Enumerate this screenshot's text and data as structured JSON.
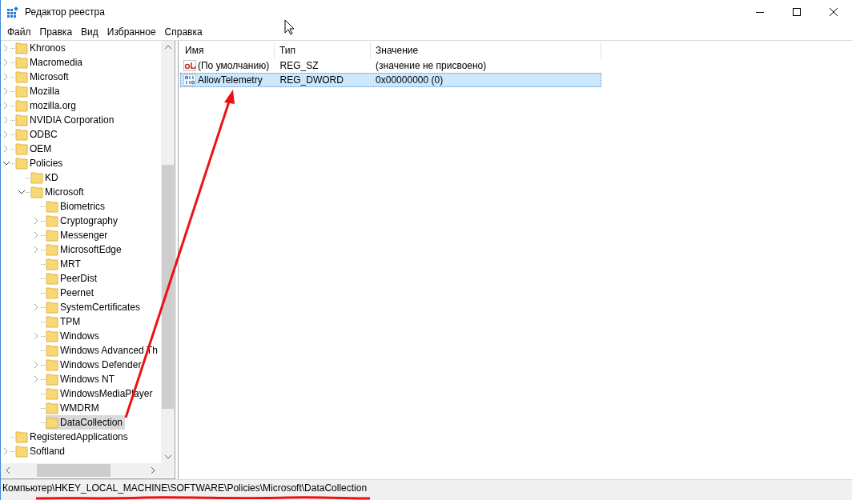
{
  "window": {
    "title": "Редактор реестра"
  },
  "menu": [
    "Файл",
    "Правка",
    "Вид",
    "Избранное",
    "Справка"
  ],
  "tree": [
    {
      "label": "Khronos",
      "has_children": true,
      "expanded": false,
      "selected": false
    },
    {
      "label": "Macromedia",
      "has_children": true,
      "expanded": false,
      "selected": false
    },
    {
      "label": "Microsoft",
      "has_children": true,
      "expanded": false,
      "selected": false
    },
    {
      "label": "Mozilla",
      "has_children": true,
      "expanded": false,
      "selected": false
    },
    {
      "label": "mozilla.org",
      "has_children": true,
      "expanded": false,
      "selected": false
    },
    {
      "label": "NVIDIA Corporation",
      "has_children": true,
      "expanded": false,
      "selected": false
    },
    {
      "label": "ODBC",
      "has_children": true,
      "expanded": false,
      "selected": false
    },
    {
      "label": "OEM",
      "has_children": true,
      "expanded": false,
      "selected": false
    },
    {
      "label": "Policies",
      "has_children": true,
      "expanded": true,
      "selected": false,
      "children": [
        {
          "label": "KD",
          "has_children": false,
          "selected": false
        },
        {
          "label": "Microsoft",
          "has_children": true,
          "expanded": true,
          "selected": false,
          "children": [
            {
              "label": "Biometrics",
              "has_children": false,
              "selected": false
            },
            {
              "label": "Cryptography",
              "has_children": true,
              "expanded": false,
              "selected": false
            },
            {
              "label": "Messenger",
              "has_children": true,
              "expanded": false,
              "selected": false
            },
            {
              "label": "MicrosoftEdge",
              "has_children": true,
              "expanded": false,
              "selected": false
            },
            {
              "label": "MRT",
              "has_children": false,
              "selected": false
            },
            {
              "label": "PeerDist",
              "has_children": false,
              "selected": false
            },
            {
              "label": "Peernet",
              "has_children": false,
              "selected": false
            },
            {
              "label": "SystemCertificates",
              "has_children": true,
              "expanded": false,
              "selected": false
            },
            {
              "label": "TPM",
              "has_children": false,
              "selected": false
            },
            {
              "label": "Windows",
              "has_children": true,
              "expanded": false,
              "selected": false
            },
            {
              "label": "Windows Advanced Th",
              "has_children": false,
              "selected": false
            },
            {
              "label": "Windows Defender",
              "has_children": true,
              "expanded": false,
              "selected": false
            },
            {
              "label": "Windows NT",
              "has_children": true,
              "expanded": false,
              "selected": false
            },
            {
              "label": "WindowsMediaPlayer",
              "has_children": false,
              "selected": false
            },
            {
              "label": "WMDRM",
              "has_children": false,
              "selected": false
            },
            {
              "label": "DataCollection",
              "has_children": false,
              "selected": true
            }
          ]
        }
      ]
    },
    {
      "label": "RegisteredApplications",
      "has_children": false,
      "selected": false
    },
    {
      "label": "Softland",
      "has_children": true,
      "expanded": false,
      "selected": false
    }
  ],
  "values": {
    "columns": [
      "Имя",
      "Тип",
      "Значение"
    ],
    "rows": [
      {
        "kind": "string",
        "name": "(По умолчанию)",
        "type": "REG_SZ",
        "data": "(значение не присвоено)",
        "selected": false
      },
      {
        "kind": "binary",
        "name": "AllowTelemetry",
        "type": "REG_DWORD",
        "data": "0x00000000 (0)",
        "selected": true
      }
    ]
  },
  "status_bar": "Компьютер\\HKEY_LOCAL_MACHINE\\SOFTWARE\\Policies\\Microsoft\\DataCollection"
}
